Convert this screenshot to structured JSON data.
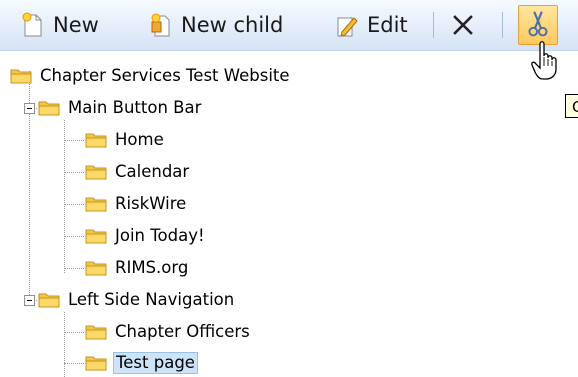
{
  "toolbar": {
    "new_label": "New",
    "new_child_label": "New child",
    "edit_label": "Edit",
    "icons": {
      "new": "new-page-icon",
      "new_child": "new-child-page-icon",
      "edit": "edit-pencil-icon",
      "delete": "delete-x-icon",
      "cut": "scissors-icon"
    }
  },
  "tooltip": {
    "text": "Cut"
  },
  "tree": {
    "root": "Chapter Services Test Website",
    "groups": [
      {
        "label": "Main Button Bar",
        "items": [
          "Home",
          "Calendar",
          "RiskWire",
          "Join Today!",
          "RIMS.org"
        ]
      },
      {
        "label": "Left Side Navigation",
        "items": [
          "Chapter Officers",
          "Test page"
        ]
      }
    ],
    "selected": "Test page"
  },
  "colors": {
    "toolbar_top": "#f7fbff",
    "toolbar_bottom": "#d5e3f5",
    "folder_fill": "#f5c848",
    "folder_edge": "#c9911a",
    "selection": "#cde3f7",
    "cut_highlight": "#ffc95e"
  }
}
